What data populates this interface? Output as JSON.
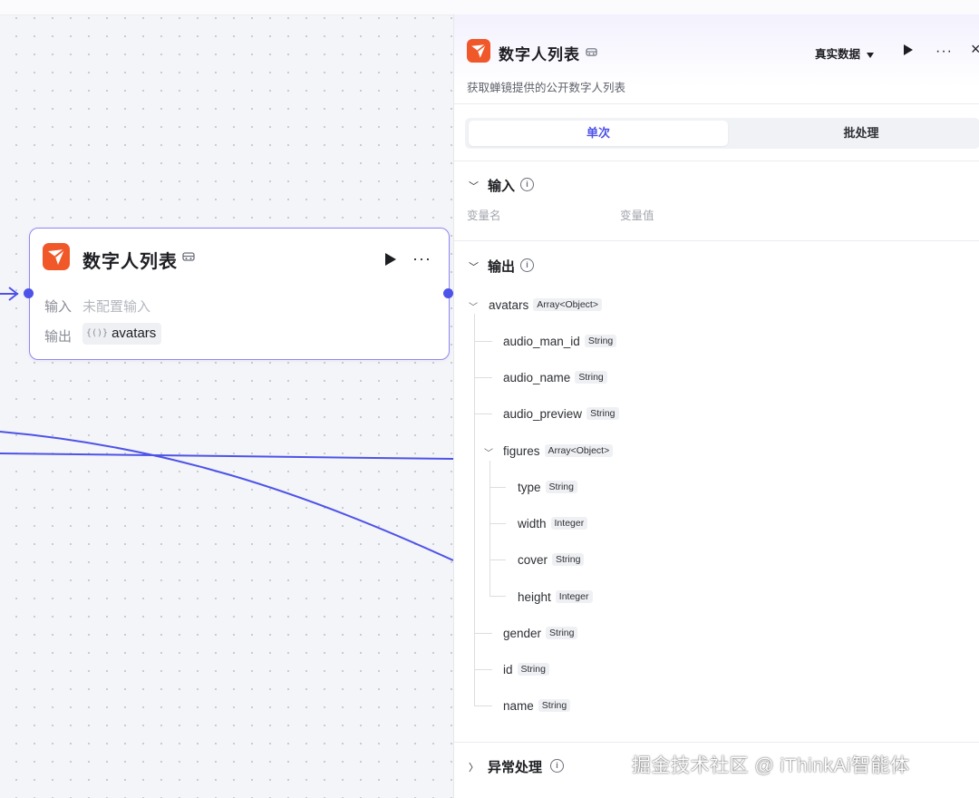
{
  "node": {
    "title": "数字人列表",
    "input_label": "输入",
    "input_value": "未配置输入",
    "output_label": "输出",
    "output_var": "avatars"
  },
  "panel": {
    "title": "数字人列表",
    "description": "获取蝉镜提供的公开数字人列表",
    "data_mode": "真实数据",
    "tabs": [
      "单次",
      "批处理"
    ],
    "input_section": {
      "title": "输入",
      "col_name": "变量名",
      "col_value": "变量值"
    },
    "output_section": {
      "title": "输出",
      "root": {
        "name": "avatars",
        "type": "Array<Object>"
      },
      "fields": [
        {
          "name": "audio_man_id",
          "type": "String"
        },
        {
          "name": "audio_name",
          "type": "String"
        },
        {
          "name": "audio_preview",
          "type": "String"
        },
        {
          "name": "figures",
          "type": "Array<Object>"
        },
        {
          "name": "type",
          "type": "String"
        },
        {
          "name": "width",
          "type": "Integer"
        },
        {
          "name": "cover",
          "type": "String"
        },
        {
          "name": "height",
          "type": "Integer"
        },
        {
          "name": "gender",
          "type": "String"
        },
        {
          "name": "id",
          "type": "String"
        },
        {
          "name": "name",
          "type": "String"
        }
      ]
    },
    "error_section": {
      "title": "异常处理"
    }
  },
  "watermark": "掘金技术社区 @ iThinkAi智能体",
  "colors": {
    "accent": "#4d53e8",
    "node_border": "#8f87f1",
    "logo": "#f0582a"
  }
}
